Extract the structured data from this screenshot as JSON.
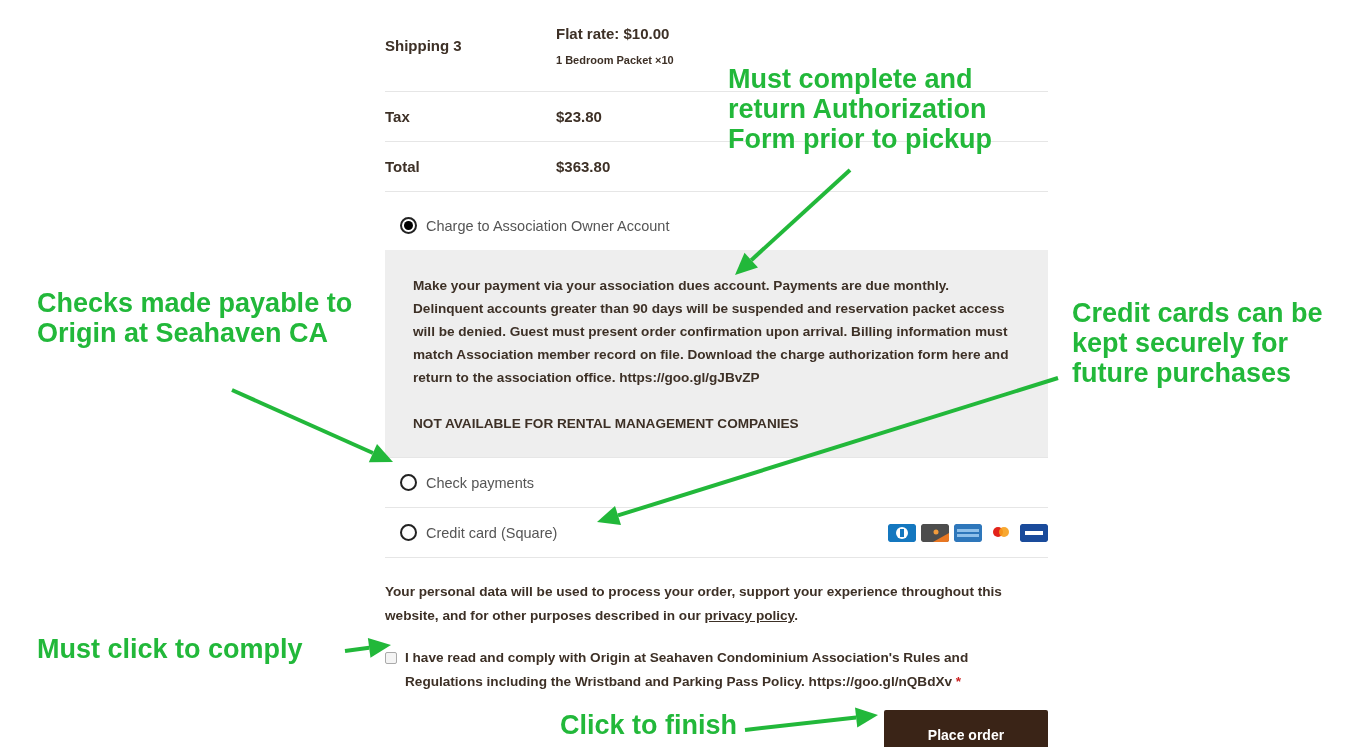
{
  "totals": [
    {
      "label": "Shipping 3",
      "value": "Flat rate: $10.00",
      "note": "1 Bedroom Packet ×10"
    },
    {
      "label": "Tax",
      "value": "$23.80"
    },
    {
      "label": "Total",
      "value": "$363.80"
    }
  ],
  "payment_methods": [
    {
      "kind": "account",
      "label": "Charge to Association Owner Account",
      "selected": true,
      "description": [
        "Make your payment via your association dues account. Payments are due monthly. Delinquent accounts greater than 90 days will be suspended and reservation packet access will be denied. Guest must present order confirmation upon arrival. Billing information must match Association member record on file. Download the charge authorization form here and return to the association office. https://goo.gl/gJBvZP",
        "NOT AVAILABLE FOR RENTAL MANAGEMENT COMPANIES"
      ]
    },
    {
      "kind": "check",
      "label": "Check payments",
      "selected": false
    },
    {
      "kind": "card",
      "label": "Credit card (Square)",
      "selected": false
    }
  ],
  "privacy": {
    "text": "Your personal data will be used to process your order, support your experience throughout this website, and for other purposes described in our ",
    "link": "privacy policy",
    "after": "."
  },
  "terms": {
    "checked": false,
    "label": "I have read and comply with Origin at Seahaven Condominium Association's Rules and Regulations including the Wristband and Parking Pass Policy. https://goo.gl/nQBdXv",
    "required": "*"
  },
  "place_order": "Place order",
  "annotations": [
    {
      "text": "Must complete and return Authorization Form prior to pickup"
    },
    {
      "text": "Checks made payable to Origin at Seahaven CA"
    },
    {
      "text": "Credit cards can be kept securely for future purchases"
    },
    {
      "text": "Must click to comply"
    },
    {
      "text": "Click to finish"
    }
  ]
}
